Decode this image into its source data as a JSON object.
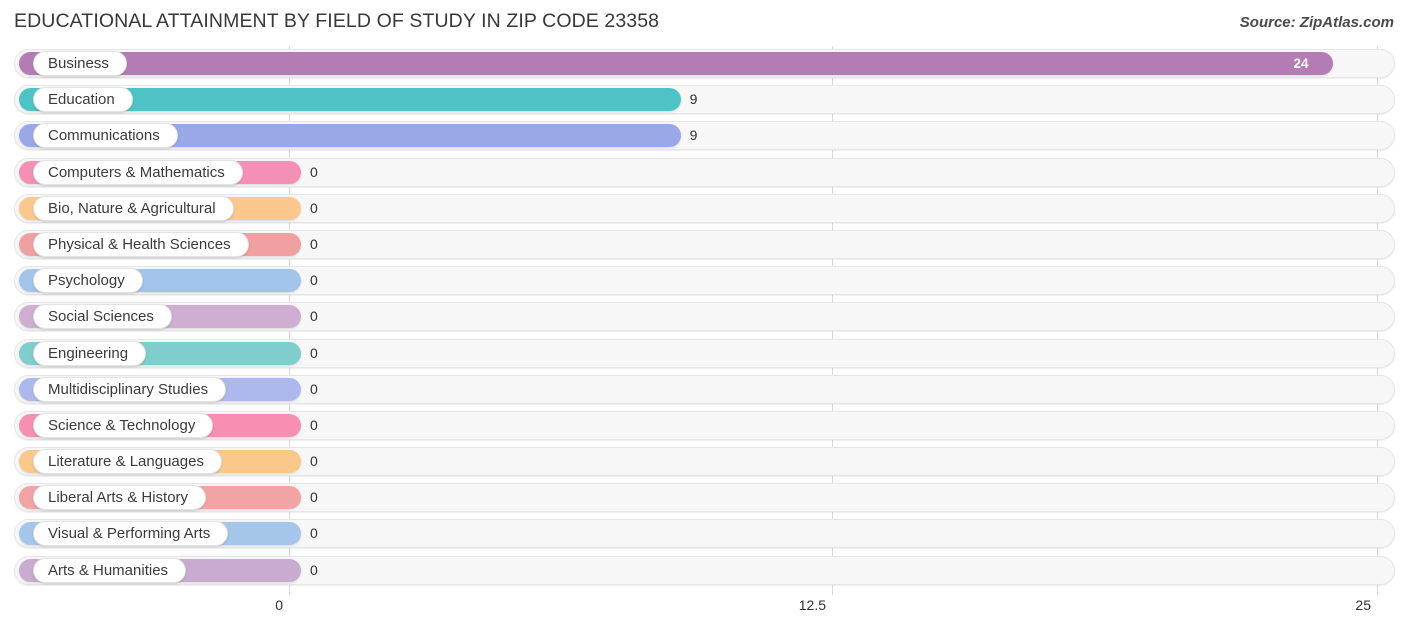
{
  "header": {
    "title": "EDUCATIONAL ATTAINMENT BY FIELD OF STUDY IN ZIP CODE 23358",
    "source": "Source: ZipAtlas.com"
  },
  "chart_data": {
    "type": "bar",
    "orientation": "horizontal",
    "title": "EDUCATIONAL ATTAINMENT BY FIELD OF STUDY IN ZIP CODE 23358",
    "xlabel": "",
    "ylabel": "",
    "xlim": [
      0,
      25
    ],
    "grid": true,
    "legend": false,
    "xticks": [
      "0",
      "12.5",
      "25"
    ],
    "xtick_values": [
      0,
      12.5,
      25
    ],
    "categories": [
      "Business",
      "Education",
      "Communications",
      "Computers & Mathematics",
      "Bio, Nature & Agricultural",
      "Physical & Health Sciences",
      "Psychology",
      "Social Sciences",
      "Engineering",
      "Multidisciplinary Studies",
      "Science & Technology",
      "Literature & Languages",
      "Liberal Arts & History",
      "Visual & Performing Arts",
      "Arts & Humanities"
    ],
    "values": [
      24,
      9,
      9,
      0,
      0,
      0,
      0,
      0,
      0,
      0,
      0,
      0,
      0,
      0,
      0
    ],
    "value_labels": [
      "24",
      "9",
      "9",
      "0",
      "0",
      "0",
      "0",
      "0",
      "0",
      "0",
      "0",
      "0",
      "0",
      "0",
      "0"
    ],
    "colors": [
      "#b57bb4",
      "#4ec3c6",
      "#9aa8e8",
      "#f490b6",
      "#fbc88b",
      "#f0a0a0",
      "#a3c4ea",
      "#cfaed1",
      "#7fcdcd",
      "#adb9ec",
      "#f78fb3",
      "#fbc88b",
      "#f2a3a3",
      "#a5c6ea",
      "#c9abd0"
    ]
  },
  "axis": {
    "ticks": [
      {
        "label": "0",
        "x": 289
      },
      {
        "label": "12.5",
        "x": 832
      },
      {
        "label": "25",
        "x": 1377
      }
    ]
  },
  "layout": {
    "bar_origin_x": 289,
    "bar_max_x": 1377,
    "min_bar_right_x": 301
  }
}
